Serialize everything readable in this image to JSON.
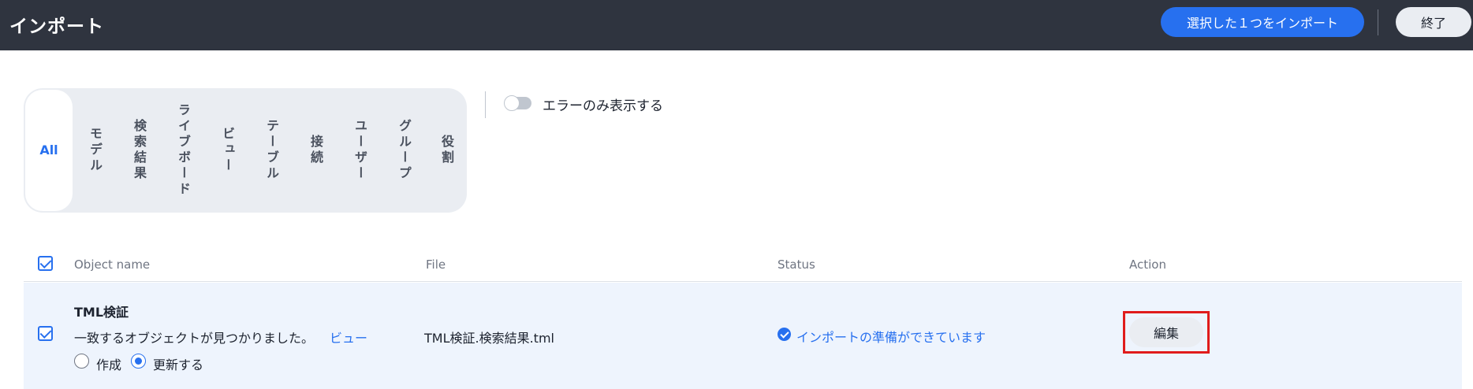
{
  "header": {
    "title": "インポート",
    "import_selected_label": "選択した１つをインポート",
    "exit_label": "終了"
  },
  "filters": {
    "tabs": [
      {
        "label": "All",
        "active": true
      },
      {
        "label": "モデル"
      },
      {
        "label": "検索結果"
      },
      {
        "label": "ライブボード"
      },
      {
        "label": "ビュー"
      },
      {
        "label": "テーブル"
      },
      {
        "label": "接続"
      },
      {
        "label": "ユーザー"
      },
      {
        "label": "グループ"
      },
      {
        "label": "役割"
      }
    ],
    "errors_only_label": "エラーのみ表示する",
    "errors_only_enabled": false
  },
  "table": {
    "columns": [
      "Object name",
      "File",
      "Status",
      "Action"
    ],
    "select_all_checked": true,
    "rows": [
      {
        "checked": true,
        "object_name": "TML検証",
        "match_message": "一致するオブジェクトが見つかりました。",
        "view_link": "ビュー",
        "options": [
          {
            "label": "作成",
            "selected": false
          },
          {
            "label": "更新する",
            "selected": true
          }
        ],
        "file": "TML検証.検索結果.tml",
        "status": "インポートの準備ができています",
        "action_label": "編集"
      }
    ]
  },
  "colors": {
    "header_bg": "#2f343f",
    "accent": "#2770ef",
    "row_selected_bg": "#eef4fd",
    "highlight_border": "#e01c1c"
  }
}
